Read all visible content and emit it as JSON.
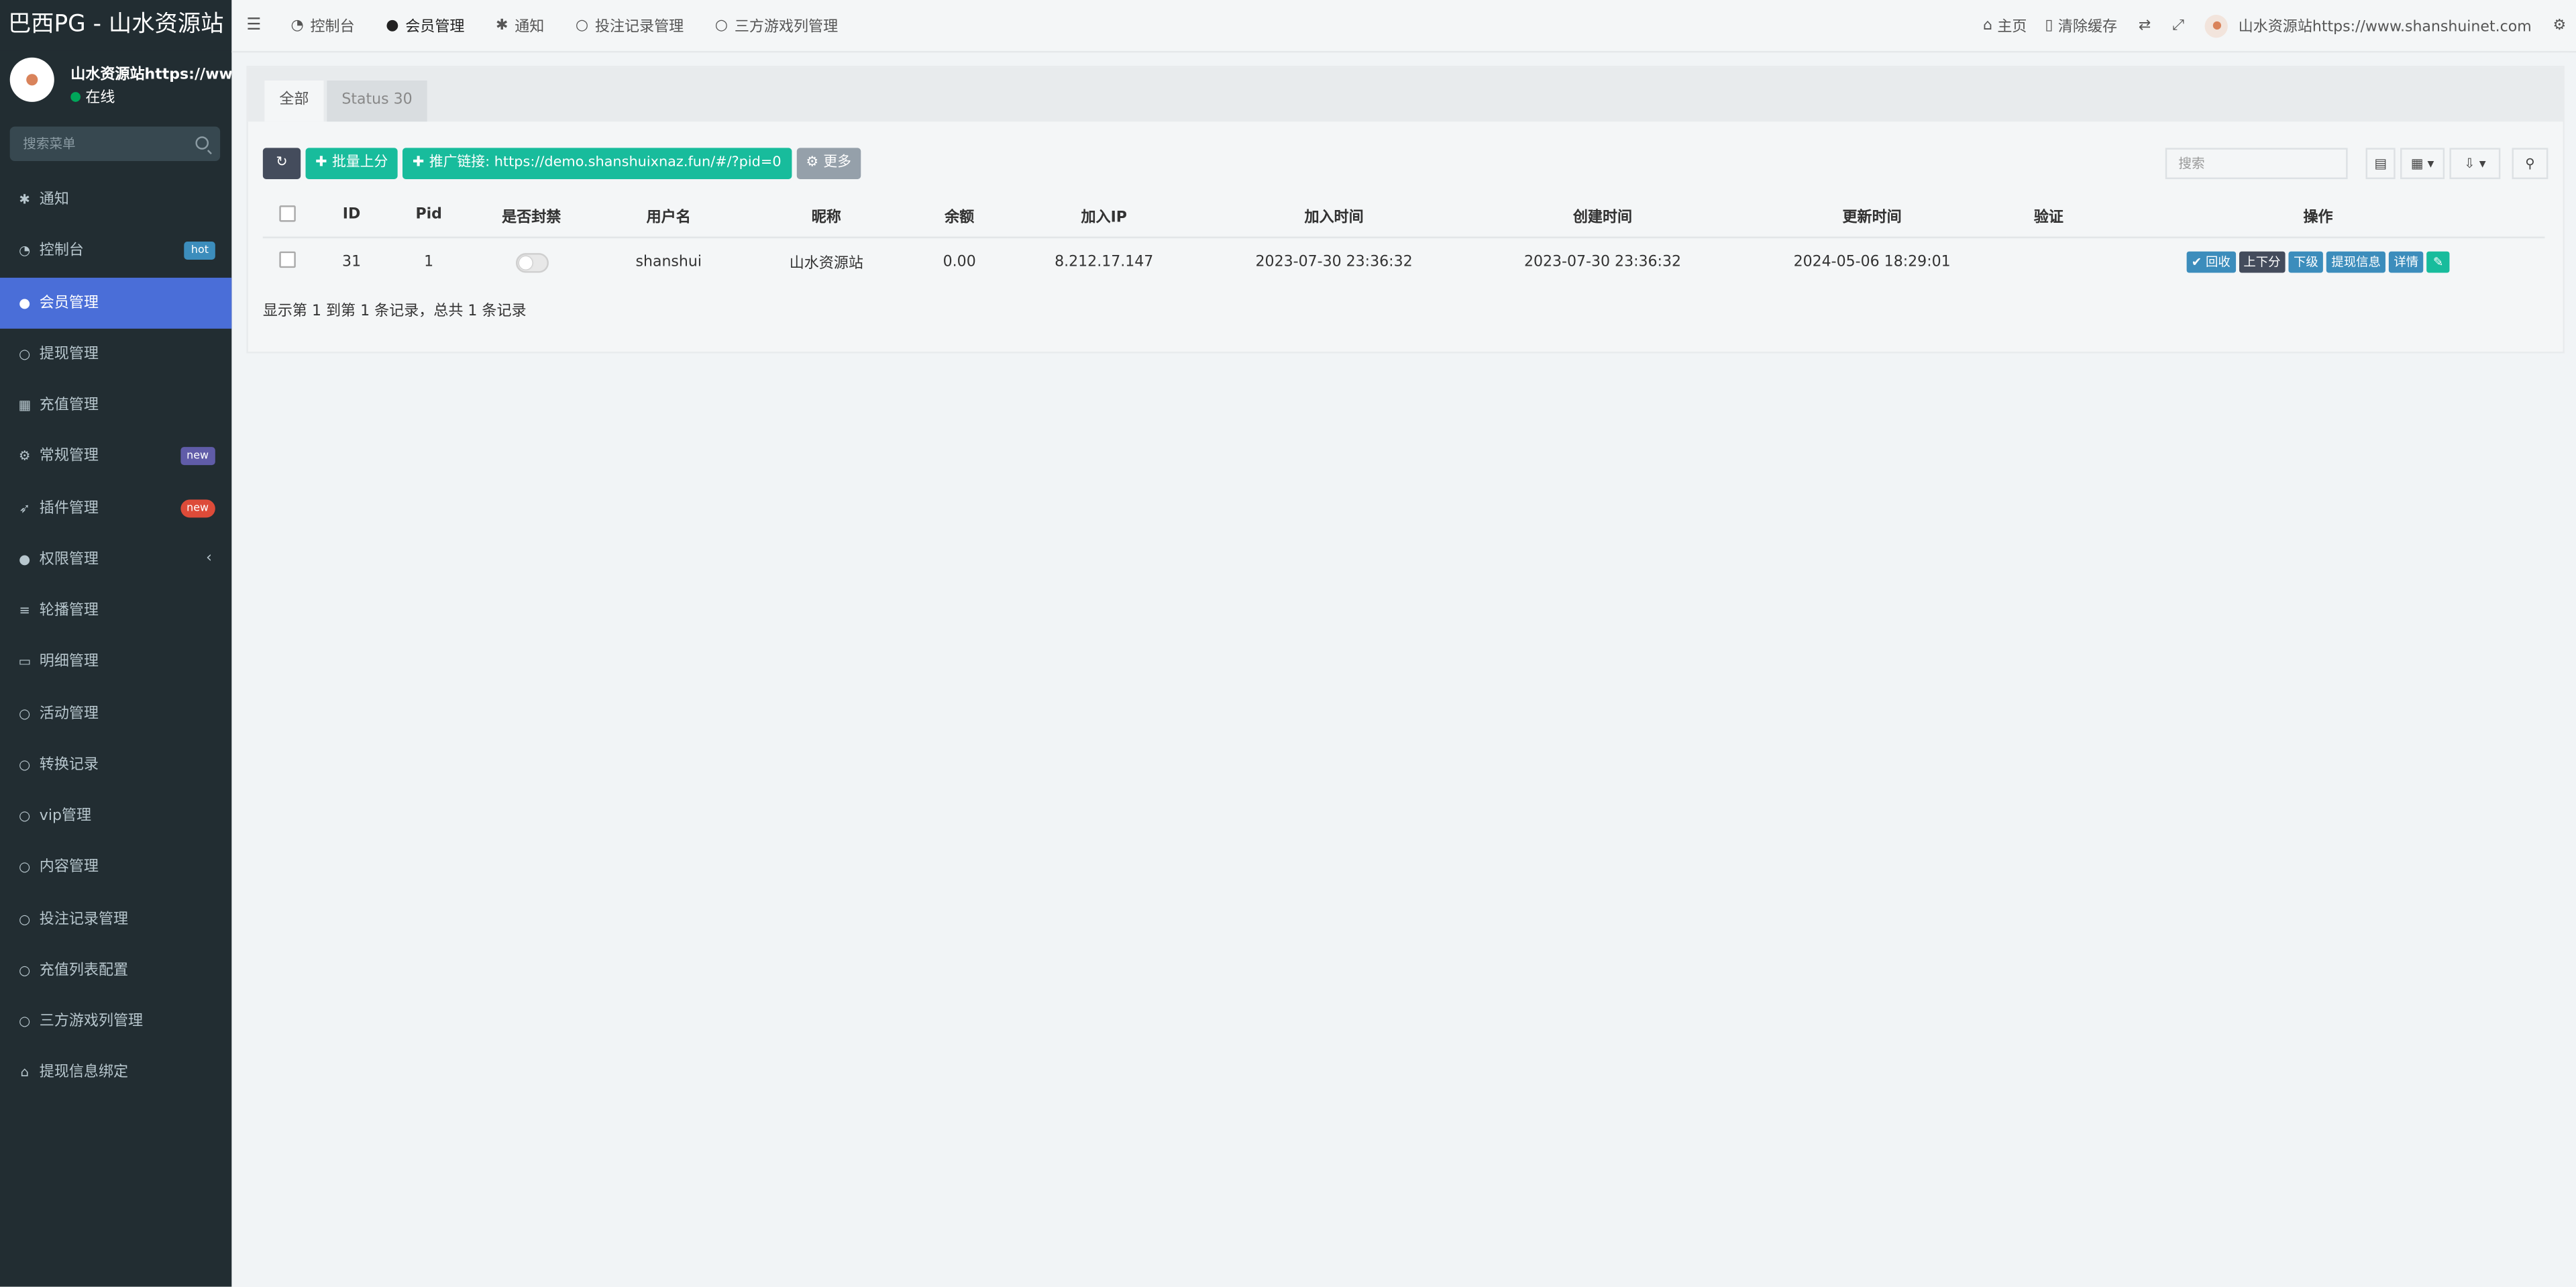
{
  "app": {
    "title": "巴西PG - 山水资源站"
  },
  "user": {
    "name": "山水资源站https://www.shanshuinet.com",
    "status": "在线"
  },
  "sidebar": {
    "search_placeholder": "搜索菜单",
    "items": [
      {
        "label": "通知",
        "icon": "asterisk-icon"
      },
      {
        "label": "控制台",
        "icon": "dashboard-icon",
        "badge": "hot"
      },
      {
        "label": "会员管理",
        "icon": "users-icon",
        "active": true
      },
      {
        "label": "提现管理",
        "icon": "circle-icon"
      },
      {
        "label": "充值管理",
        "icon": "grid-icon"
      },
      {
        "label": "常规管理",
        "icon": "cogs-icon",
        "badge": "new"
      },
      {
        "label": "插件管理",
        "icon": "rocket-icon",
        "badge": "new"
      },
      {
        "label": "权限管理",
        "icon": "group-icon"
      },
      {
        "label": "轮播管理",
        "icon": "list-icon"
      },
      {
        "label": "明细管理",
        "icon": "calendar-icon"
      },
      {
        "label": "活动管理",
        "icon": "circle-icon"
      },
      {
        "label": "转换记录",
        "icon": "circle-icon"
      },
      {
        "label": "vip管理",
        "icon": "circle-icon"
      },
      {
        "label": "内容管理",
        "icon": "circle-icon"
      },
      {
        "label": "投注记录管理",
        "icon": "circle-icon"
      },
      {
        "label": "充值列表配置",
        "icon": "circle-icon"
      },
      {
        "label": "三方游戏列管理",
        "icon": "circle-icon"
      },
      {
        "label": "提现信息绑定",
        "icon": "bank-icon"
      }
    ]
  },
  "header": {
    "nav": [
      {
        "label": "控制台",
        "icon": "dashboard-icon"
      },
      {
        "label": "会员管理",
        "icon": "users-icon"
      },
      {
        "label": "通知",
        "icon": "asterisk-icon"
      },
      {
        "label": "投注记录管理",
        "icon": "circle-icon"
      },
      {
        "label": "三方游戏列管理",
        "icon": "circle-icon"
      }
    ],
    "home": "主页",
    "clear_cache": "清除缓存",
    "user_label": "山水资源站https://www.shanshuinet.com"
  },
  "tabs": [
    "全部",
    "Status 30"
  ],
  "toolbar": {
    "batch_add": "批量上分",
    "promo_link": "推广链接: https://demo.shanshuixnaz.fun/#/?pid=0",
    "more": "更多",
    "search_placeholder": "搜索"
  },
  "table": {
    "columns": [
      "ID",
      "Pid",
      "是否封禁",
      "用户名",
      "昵称",
      "余额",
      "加入IP",
      "加入时间",
      "创建时间",
      "更新时间",
      "验证",
      "操作"
    ],
    "rows": [
      {
        "id": "31",
        "pid": "1",
        "banned": false,
        "username": "shanshui",
        "nickname": "山水资源站",
        "balance": "0.00",
        "join_ip": "8.212.17.147",
        "join_time": "2023-07-30 23:36:32",
        "create_time": "2023-07-30 23:36:32",
        "update_time": "2024-05-06 18:29:01",
        "verify": ""
      }
    ],
    "actions": [
      "回收",
      "上下分",
      "下级",
      "提现信息",
      "详情"
    ]
  },
  "pagination": {
    "info": "显示第 1 到第 1 条记录，总共 1 条记录"
  }
}
